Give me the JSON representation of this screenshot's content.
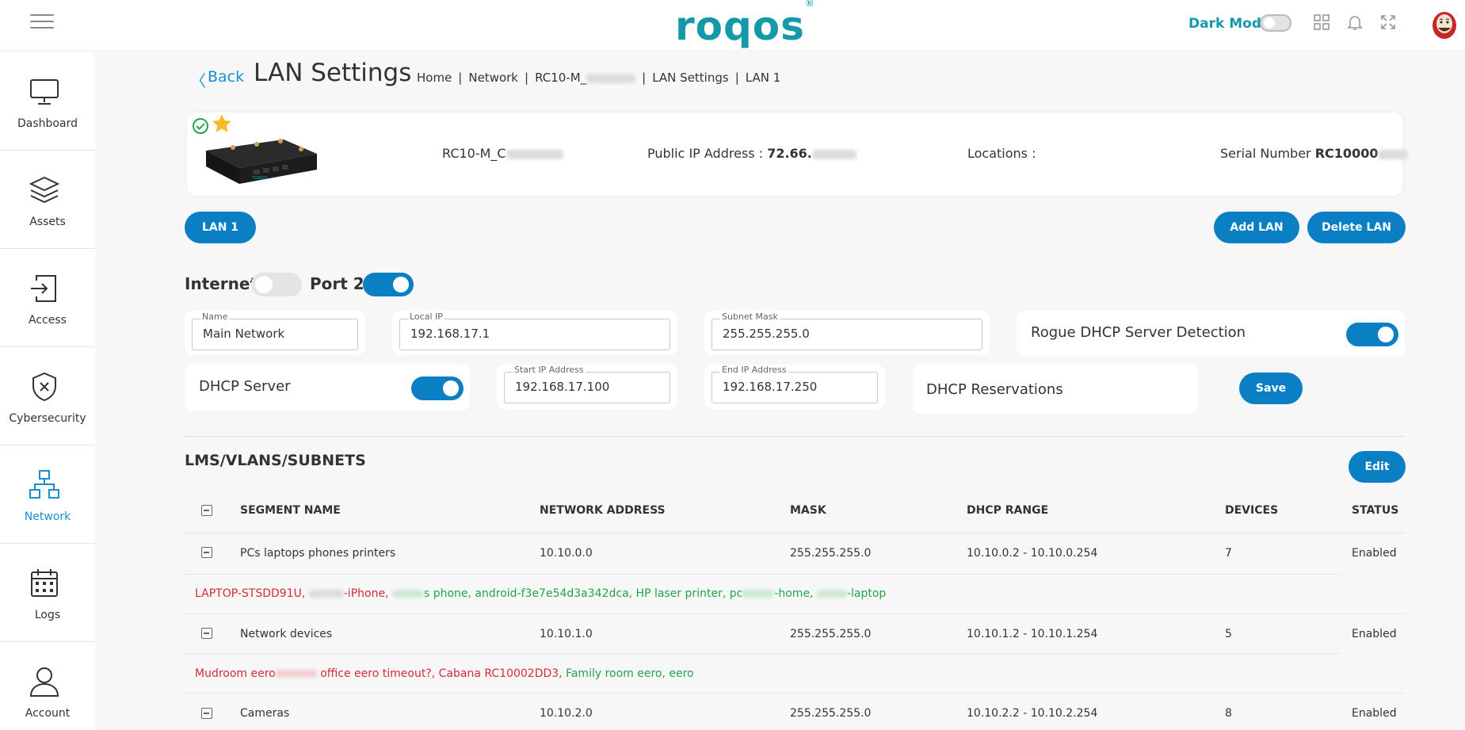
{
  "topbar": {
    "logo": "roqos",
    "logo_mark": "®",
    "dark_mode_label": "Dark Mode",
    "icons": [
      "grid-icon",
      "bell-icon",
      "fullscreen-icon"
    ]
  },
  "sidebar": {
    "items": [
      {
        "label": "Dashboard",
        "icon": "monitor-icon"
      },
      {
        "label": "Assets",
        "icon": "layers-icon"
      },
      {
        "label": "Access",
        "icon": "login-icon"
      },
      {
        "label": "Cybersecurity",
        "icon": "shield-x-icon"
      },
      {
        "label": "Network",
        "icon": "network-icon"
      },
      {
        "label": "Logs",
        "icon": "calendar-icon"
      },
      {
        "label": "Account",
        "icon": "user-icon"
      }
    ],
    "active": "Network"
  },
  "header": {
    "back": "Back",
    "title": "LAN Settings",
    "breadcrumb": [
      "Home",
      "Network",
      "RC10-M_",
      "LAN Settings",
      "LAN 1"
    ]
  },
  "device": {
    "name": "RC10-M_C",
    "public_ip_label": "Public IP Address :",
    "public_ip": "72.66.",
    "locations_label": "Locations :",
    "serial_label": "Serial Number",
    "serial": "RC10000"
  },
  "lan_tab": "LAN 1",
  "actions": {
    "add": "Add LAN",
    "delete": "Delete LAN"
  },
  "toggles": {
    "internet": "Internet",
    "port": "Port 2"
  },
  "form": {
    "name_label": "Name",
    "name_value": "Main Network",
    "local_ip_label": "Local IP",
    "local_ip_value": "192.168.17.1",
    "subnet_label": "Subnet Mask",
    "subnet_value": "255.255.255.0",
    "rogue_dhcp": "Rogue DHCP Server Detection",
    "dhcp_server": "DHCP Server",
    "start_ip_label": "Start IP Address",
    "start_ip_value": "192.168.17.100",
    "end_ip_label": "End IP Address",
    "end_ip_value": "192.168.17.250",
    "reservations": "DHCP Reservations",
    "save": "Save"
  },
  "segments": {
    "title": "LMS/VLANS/SUBNETS",
    "edit": "Edit",
    "columns": [
      "SEGMENT NAME",
      "NETWORK ADDRESS",
      "MASK",
      "DHCP RANGE",
      "DEVICES",
      "STATUS"
    ],
    "rows": [
      {
        "name": "PCs laptops phones printers",
        "network": "10.10.0.0",
        "mask": "255.255.255.0",
        "range": "10.10.0.2 - 10.10.0.254",
        "devices": "7",
        "status": "Enabled",
        "device_list": [
          {
            "text": "LAPTOP-STSDD91U, ",
            "color": "red"
          },
          {
            "text": "-iPhone, ",
            "color": "red"
          },
          {
            "text": "s phone, android-f3e7e54d3a342dca, HP laser printer, pc",
            "color": "green"
          },
          {
            "text": "-home, ",
            "color": "green"
          },
          {
            "text": "-laptop",
            "color": "green"
          }
        ]
      },
      {
        "name": "Network devices",
        "network": "10.10.1.0",
        "mask": "255.255.255.0",
        "range": "10.10.1.2 - 10.10.1.254",
        "devices": "5",
        "status": "Enabled",
        "device_list": [
          {
            "text": "Mudroom eero",
            "color": "red"
          },
          {
            "text": " office eero timeout?, Cabana RC10002DD3, ",
            "color": "red"
          },
          {
            "text": "Family room eero, eero",
            "color": "green"
          }
        ]
      },
      {
        "name": "Cameras",
        "network": "10.10.2.0",
        "mask": "255.255.255.0",
        "range": "10.10.2.2 - 10.10.2.254",
        "devices": "8",
        "status": "Enabled"
      }
    ]
  }
}
